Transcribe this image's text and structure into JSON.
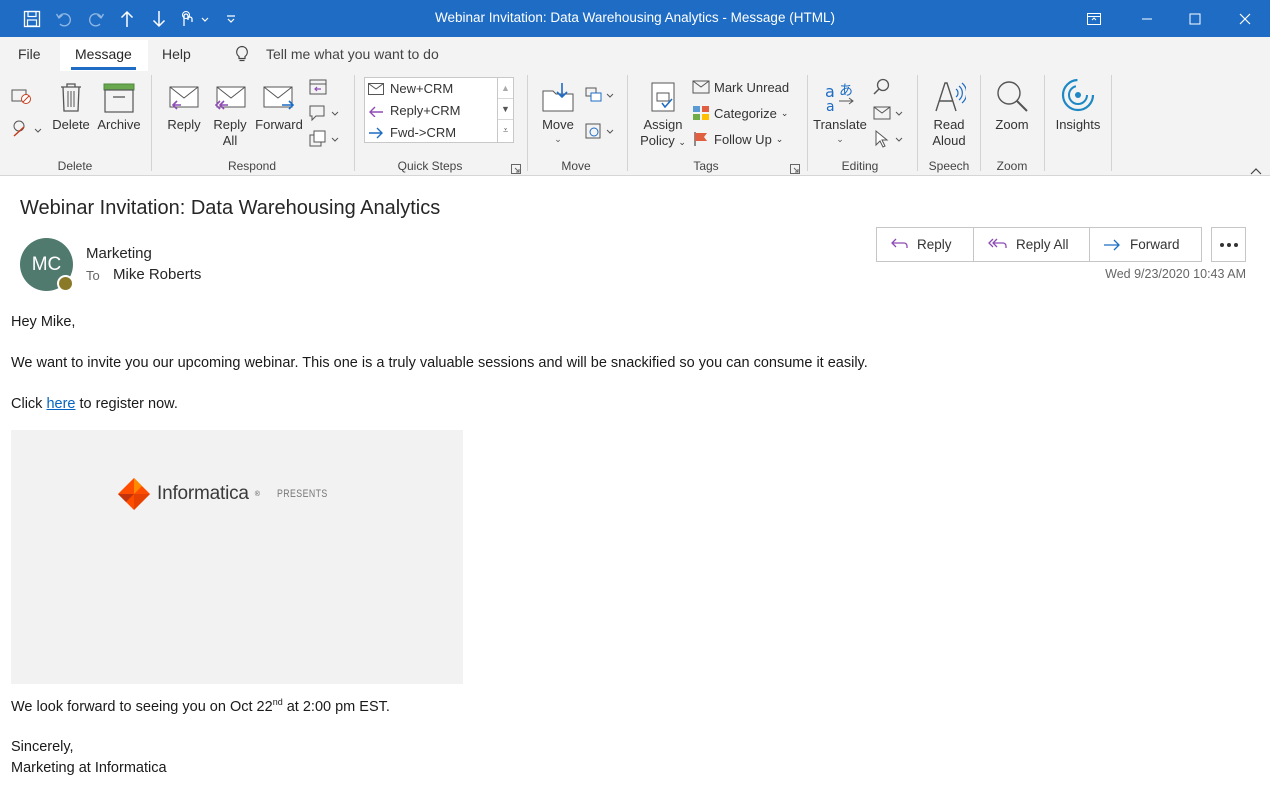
{
  "window": {
    "title": "Webinar Invitation: Data Warehousing Analytics  -  Message (HTML)"
  },
  "menu": {
    "tabs": [
      "File",
      "Message",
      "Help"
    ],
    "active_tab": "Message",
    "tell_me": "Tell me what you want to do"
  },
  "ribbon": {
    "delete_group": {
      "label": "Delete",
      "delete": "Delete",
      "archive": "Archive"
    },
    "respond_group": {
      "label": "Respond",
      "reply": "Reply",
      "reply_all_1": "Reply",
      "reply_all_2": "All",
      "forward": "Forward"
    },
    "quick_steps": {
      "label": "Quick Steps",
      "items": [
        "New+CRM",
        "Reply+CRM",
        "Fwd->CRM"
      ]
    },
    "move_group": {
      "label": "Move",
      "move": "Move"
    },
    "tags_group": {
      "label": "Tags",
      "assign_policy_1": "Assign",
      "assign_policy_2": "Policy",
      "mark_unread": "Mark Unread",
      "categorize": "Categorize",
      "follow_up": "Follow Up"
    },
    "editing_group": {
      "label": "Editing",
      "translate": "Translate"
    },
    "speech_group": {
      "label": "Speech",
      "read_aloud_1": "Read",
      "read_aloud_2": "Aloud"
    },
    "zoom_group": {
      "label": "Zoom",
      "zoom": "Zoom"
    },
    "insights": {
      "label": "Insights"
    }
  },
  "message": {
    "subject": "Webinar Invitation: Data Warehousing Analytics",
    "avatar_initials": "MC",
    "sender": "Marketing",
    "to_label": "To",
    "to_name": "Mike Roberts",
    "actions": {
      "reply": "Reply",
      "reply_all": "Reply All",
      "forward": "Forward"
    },
    "datetime": "Wed 9/23/2020 10:43 AM"
  },
  "body": {
    "greeting": "Hey Mike,",
    "paragraph1": "We want to invite you our upcoming webinar. This one is a truly valuable sessions and will be snackified so you can consume it easily.",
    "click_prefix": "Click",
    "click_link": "here",
    "click_suffix": "to register now.",
    "banner_brand": "Informatica",
    "banner_tm": "®",
    "banner_presents": "PRESENTS",
    "closing_prefix": "We look forward to seeing you on Oct 22",
    "closing_sup": "nd",
    "closing_suffix": "at 2:00 pm EST.",
    "signoff": "Sincerely,",
    "signature": "Marketing at Informatica"
  },
  "colors": {
    "titlebar": "#1e6cc4",
    "avatar": "#507a6e",
    "link": "#0563c1"
  }
}
